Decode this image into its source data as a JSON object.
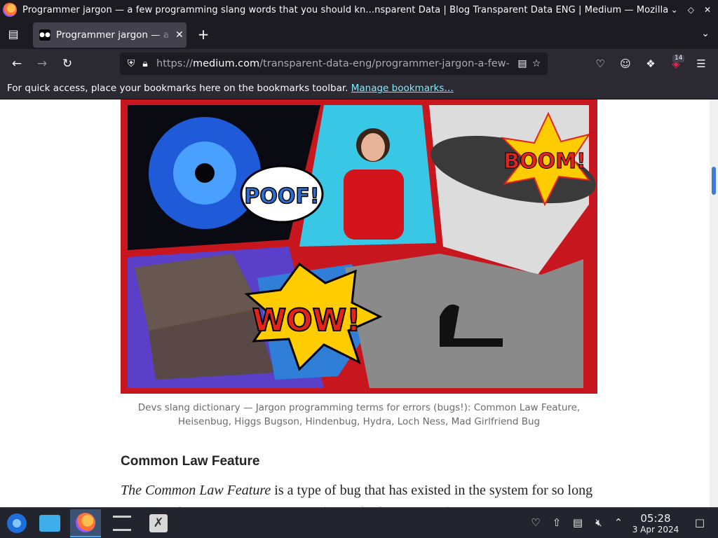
{
  "window": {
    "title": "Programmer jargon — a few programming slang words that you should kn...nsparent Data | Blog Transparent Data ENG | Medium — Mozilla Firefox"
  },
  "tabs": [
    {
      "label": "Programmer jargon — a few programming slang words",
      "favicon": "medium-logo",
      "active": true
    }
  ],
  "navbar": {
    "url_prefix": "https://",
    "url_host": "medium.com",
    "url_path": "/transparent-data-eng/programmer-jargon-a-few-",
    "extensions_badge": "14"
  },
  "bookmarks_bar": {
    "message": "For quick access, place your bookmarks here on the bookmarks toolbar. ",
    "link": "Manage bookmarks…"
  },
  "article": {
    "hero_words": [
      "POOF!",
      "BOOM!",
      "WOW!"
    ],
    "caption": "Devs slang dictionary — Jargon programming terms for errors (bugs!): Common Law Feature, Heisenbug, Higgs Bugson, Hindenbug, Hydra, Loch Ness, Mad Girlfriend Bug",
    "heading": "Common Law Feature",
    "paragraph_em": "The Common Law Feature",
    "paragraph_rest": " is a type of bug that has existed in the system for so long that it has become an integral part of it. Nobody wants to fix it"
  },
  "taskbar": {
    "time": "05:28",
    "date": "3 Apr 2024"
  },
  "colors": {
    "titlebar": "#1c1b22",
    "toolbar": "#2b2a33",
    "link": "#80ebff",
    "taskbar": "#23252e",
    "hero_red": "#c8161e"
  }
}
